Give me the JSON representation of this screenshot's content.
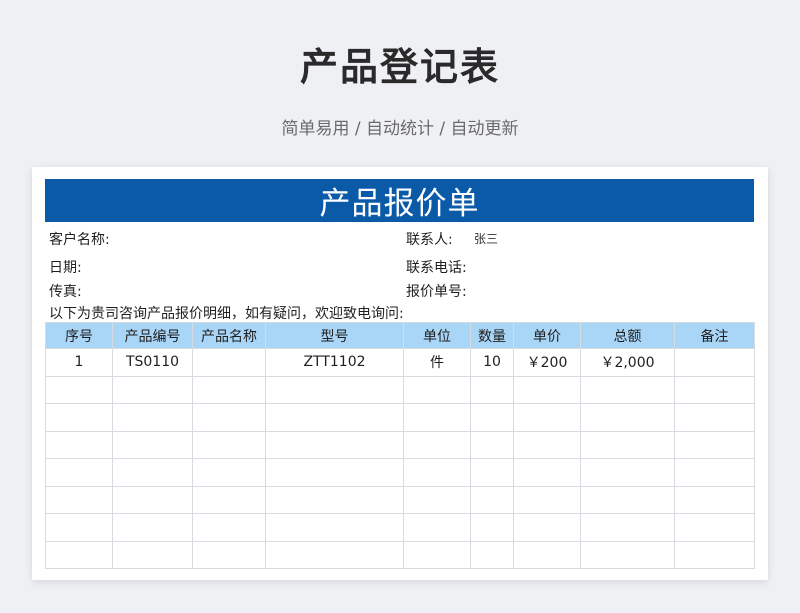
{
  "page": {
    "title": "产品登记表",
    "subtitle": "简单易用 / 自动统计 / 自动更新"
  },
  "sheet": {
    "banner": "产品报价单",
    "info": {
      "customer_label": "客户名称:",
      "contact_label": "联系人:",
      "contact_value": "张三",
      "date_label": "日期:",
      "phone_label": "联系电话:",
      "fax_label": "传真:",
      "quote_no_label": "报价单号:"
    },
    "notice": "以下为贵司咨询产品报价明细，如有疑问，欢迎致电询问:",
    "columns": [
      "序号",
      "产品编号",
      "产品名称",
      "型号",
      "单位",
      "数量",
      "单价",
      "总额",
      "备注"
    ],
    "rows": [
      [
        "1",
        "TS0110",
        "",
        "ZTT1102",
        "件",
        "10",
        "￥200",
        "￥2,000",
        ""
      ],
      [
        "",
        "",
        "",
        "",
        "",
        "",
        "",
        "",
        ""
      ],
      [
        "",
        "",
        "",
        "",
        "",
        "",
        "",
        "",
        ""
      ],
      [
        "",
        "",
        "",
        "",
        "",
        "",
        "",
        "",
        ""
      ],
      [
        "",
        "",
        "",
        "",
        "",
        "",
        "",
        "",
        ""
      ],
      [
        "",
        "",
        "",
        "",
        "",
        "",
        "",
        "",
        ""
      ],
      [
        "",
        "",
        "",
        "",
        "",
        "",
        "",
        "",
        ""
      ],
      [
        "",
        "",
        "",
        "",
        "",
        "",
        "",
        "",
        ""
      ]
    ]
  },
  "colors": {
    "banner": "#0b5aa8",
    "header_row": "#a9d6f7",
    "background": "#eef0f4"
  }
}
